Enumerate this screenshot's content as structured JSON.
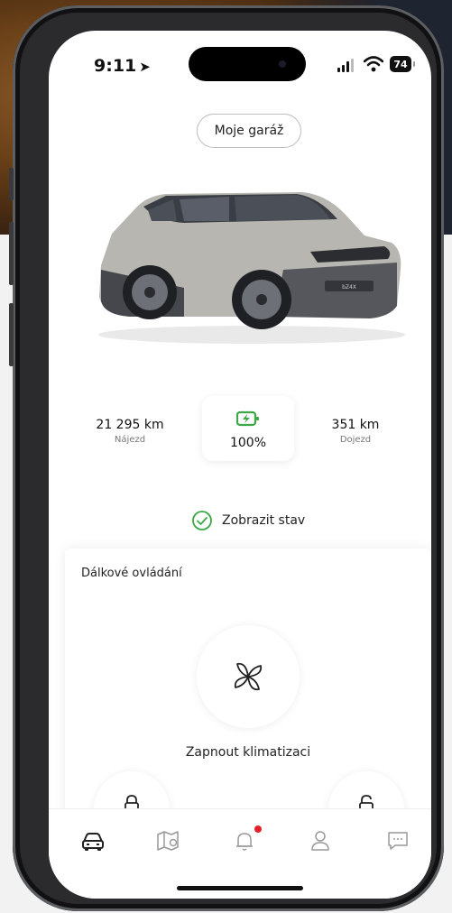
{
  "status_bar": {
    "time": "9:11",
    "battery": "74"
  },
  "header": {
    "garage_button": "Moje garáž"
  },
  "car": {
    "plate_text": "bZ4X"
  },
  "stats": {
    "mileage_value": "21 295 km",
    "mileage_label": "Nájezd",
    "charge_value": "100%",
    "range_value": "351 km",
    "range_label": "Dojezd"
  },
  "show_status": {
    "label": "Zobrazit stav"
  },
  "remote": {
    "title": "Dálkové ovládání",
    "climate_label": "Zapnout klimatizaci"
  },
  "tabbar": {
    "items": [
      {
        "icon": "car-icon"
      },
      {
        "icon": "map-icon"
      },
      {
        "icon": "bell-icon"
      },
      {
        "icon": "person-icon"
      },
      {
        "icon": "chat-icon"
      }
    ]
  },
  "colors": {
    "accent_green": "#3aa845",
    "badge_red": "#e4202c",
    "text_dark": "#222222"
  }
}
